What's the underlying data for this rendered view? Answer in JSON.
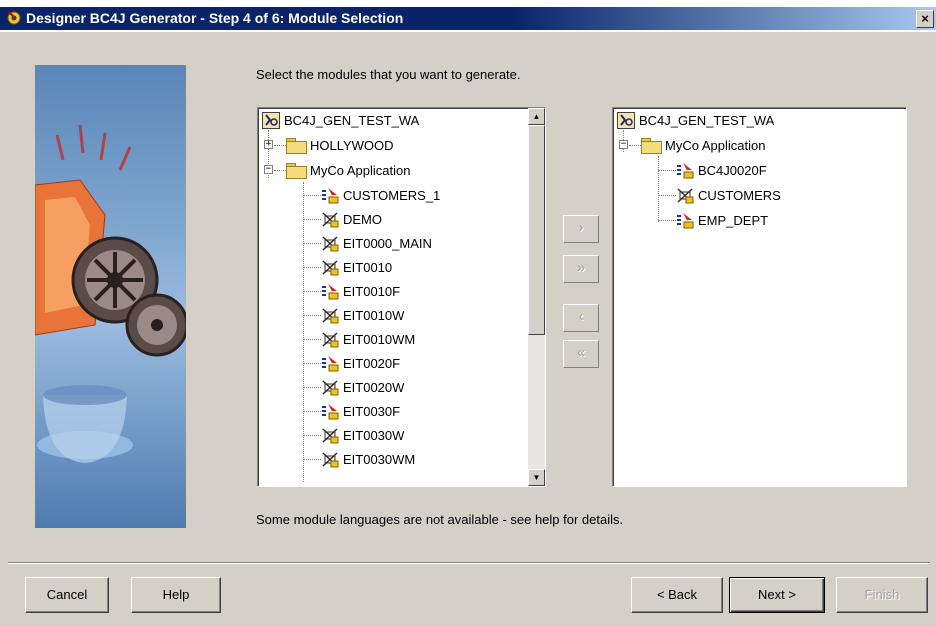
{
  "window": {
    "title": "Designer BC4J Generator - Step 4 of 6: Module Selection",
    "close_glyph": "×"
  },
  "instruction": "Select the modules that you want to generate.",
  "left_tree": {
    "root": "BC4J_GEN_TEST_WA",
    "items": [
      {
        "label": "HOLLYWOOD",
        "type": "folder",
        "expanded": false
      },
      {
        "label": "MyCo Application",
        "type": "folder-open",
        "expanded": true
      },
      {
        "label": "CUSTOMERS_1",
        "type": "form-module"
      },
      {
        "label": "DEMO",
        "type": "module"
      },
      {
        "label": "EIT0000_MAIN",
        "type": "module"
      },
      {
        "label": "EIT0010",
        "type": "module"
      },
      {
        "label": "EIT0010F",
        "type": "form-module"
      },
      {
        "label": "EIT0010W",
        "type": "module"
      },
      {
        "label": "EIT0010WM",
        "type": "module"
      },
      {
        "label": "EIT0020F",
        "type": "form-module"
      },
      {
        "label": "EIT0020W",
        "type": "module"
      },
      {
        "label": "EIT0030F",
        "type": "form-module"
      },
      {
        "label": "EIT0030W",
        "type": "module"
      },
      {
        "label": "EIT0030WM",
        "type": "module"
      }
    ]
  },
  "right_tree": {
    "root": "BC4J_GEN_TEST_WA",
    "items": [
      {
        "label": "MyCo Application",
        "type": "folder-open",
        "expanded": true
      },
      {
        "label": "BC4J0020F",
        "type": "form-module"
      },
      {
        "label": "CUSTOMERS",
        "type": "module"
      },
      {
        "label": "EMP_DEPT",
        "type": "form-module"
      }
    ]
  },
  "shuttle_buttons": {
    "move_one": "›",
    "move_all": "»",
    "remove_one": "‹",
    "remove_all": "«"
  },
  "note": "Some module languages are not available - see help for details.",
  "buttons": {
    "cancel": "Cancel",
    "help": "Help",
    "back": "< Back",
    "next": "Next >",
    "finish": "Finish"
  },
  "colors": {
    "titlebar": "#0a246a",
    "dialog": "#d4d0c8",
    "disabled_text": "#a0a0a0"
  }
}
